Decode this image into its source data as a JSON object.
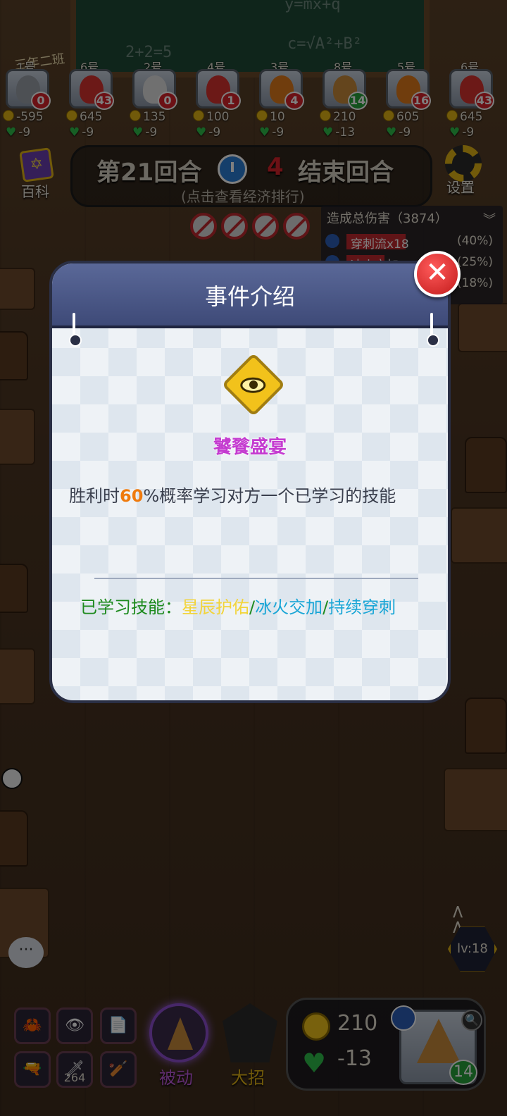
{
  "blackboard": {
    "chalk_1": "y=mx+q",
    "chalk_2": "2+2=5",
    "chalk_3": "c=√A²+B²",
    "sign": "三年二班"
  },
  "players": [
    {
      "num": "1号",
      "badge": "0",
      "badge_color": "red",
      "gold": "-595",
      "hp": "-9",
      "char_color": "#9aa0a8"
    },
    {
      "num": "6号",
      "badge": "43",
      "badge_color": "red",
      "gold": "645",
      "hp": "-9",
      "char_color": "#d8332f"
    },
    {
      "num": "2号",
      "badge": "0",
      "badge_color": "red",
      "gold": "135",
      "hp": "-9",
      "char_color": "#e0e0e0"
    },
    {
      "num": "4号",
      "badge": "1",
      "badge_color": "red",
      "gold": "100",
      "hp": "-9",
      "char_color": "#d8332f"
    },
    {
      "num": "3号",
      "badge": "4",
      "badge_color": "red",
      "gold": "10",
      "hp": "-9",
      "char_color": "#e07a1a"
    },
    {
      "num": "8号",
      "badge": "14",
      "badge_color": "green",
      "gold": "210",
      "hp": "-13",
      "char_color": "#c98a3a"
    },
    {
      "num": "5号",
      "badge": "16",
      "badge_color": "red",
      "gold": "605",
      "hp": "-9",
      "char_color": "#e07a1a"
    },
    {
      "num": "6号",
      "badge": "43",
      "badge_color": "red",
      "gold": "645",
      "hp": "-9",
      "char_color": "#d8332f"
    }
  ],
  "top_bar": {
    "wiki_label": "百科",
    "round_label": "第21回合",
    "countdown": "4",
    "end_round_label": "结束回合",
    "economy_hint": "(点击查看经济排行)",
    "settings_label": "设置"
  },
  "damage_panel": {
    "title": "造成总伤害（3874）",
    "rows": [
      {
        "name": "穿刺流x18",
        "pct": "(40%)"
      },
      {
        "name": "冰火交加",
        "pct": "(25%)"
      },
      {
        "name": "",
        "pct": "(18%)"
      }
    ]
  },
  "modal": {
    "title": "事件介绍",
    "close_glyph": "✕",
    "event_name": "饕餮盛宴",
    "desc_before": "胜利时",
    "desc_highlight": "60",
    "desc_after": "%概率学习对方一个已学习的技能",
    "learned_label": "已学习技能：",
    "skill_1": "星辰护佑",
    "sep": "/",
    "skill_2": "冰火交加",
    "skill_3": "持续穿刺"
  },
  "side": {
    "level": "lv:18",
    "chat_glyph": "···",
    "arrows": "<<"
  },
  "bottom": {
    "skill_slots": [
      {
        "glyph": "🦀",
        "count": ""
      },
      {
        "glyph": "👁",
        "count": ""
      },
      {
        "glyph": "📄",
        "count": ""
      },
      {
        "glyph": "🔫",
        "count": ""
      },
      {
        "glyph": "🗡",
        "count": "264"
      },
      {
        "glyph": "🏏",
        "count": ""
      }
    ],
    "passive_label": "被动",
    "ultimate_label": "大招",
    "gold": "210",
    "hp": "-13",
    "avatar_badge": "14",
    "search_glyph": "🔍"
  }
}
